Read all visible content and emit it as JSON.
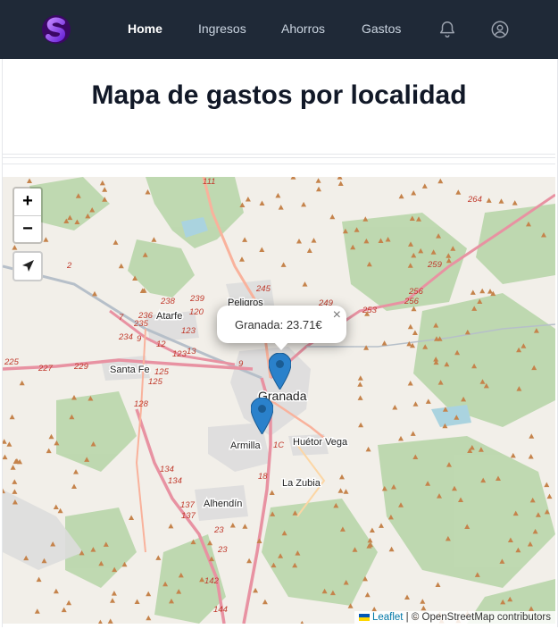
{
  "nav": {
    "links": [
      {
        "label": "Home",
        "active": true
      },
      {
        "label": "Ingresos",
        "active": false
      },
      {
        "label": "Ahorros",
        "active": false
      },
      {
        "label": "Gastos",
        "active": false
      }
    ],
    "icons": [
      "logo-s-icon",
      "bell-icon",
      "user-icon"
    ]
  },
  "page": {
    "title": "Mapa de gastos por localidad"
  },
  "map": {
    "zoom_in": "+",
    "zoom_out": "−",
    "locate_icon": "location-arrow-icon",
    "popup": {
      "text": "Granada: 23.71€",
      "close": "×"
    },
    "markers": [
      {
        "name": "Granada",
        "amount": "23.71€"
      },
      {
        "name": "Armilla"
      }
    ],
    "places": {
      "granada": "Granada",
      "armilla": "Armilla",
      "huetor": "Huétor Vega",
      "zubia": "La Zubia",
      "alhendin": "Alhendín",
      "santafe": "Santa Fe",
      "atarfe": "Atarfe",
      "peligros": "Peligros"
    },
    "road_numbers": {
      "r111": "111",
      "r264": "264",
      "r259": "259",
      "r256a": "256",
      "r256b": "256",
      "r253": "253",
      "r249": "249",
      "r245": "245",
      "r238": "238",
      "r239": "239",
      "r236": "236",
      "r235": "235",
      "r234": "234",
      "r227": "227",
      "r229": "229",
      "r225": "225",
      "r2": "2",
      "r7": "7",
      "r9a": "9",
      "r9b": "9",
      "r12": "12",
      "r123a": "123",
      "r123b": "123",
      "r13": "13",
      "r125a": "125",
      "r125b": "125",
      "r128": "128",
      "r134a": "134",
      "r134b": "134",
      "r137a": "137",
      "r137b": "137",
      "r23a": "23",
      "r23b": "23",
      "r142": "142",
      "r144": "144",
      "r18": "18",
      "r1c": "1C",
      "r120": "120"
    },
    "colors": {
      "land": "#f2efe9",
      "forest": "#add19e",
      "motorway": "#e892a2",
      "trunk": "#f9b29c",
      "urban": "#dddddd",
      "water": "#aad3df",
      "peak": "#c5834b",
      "marker": "#2a81cb"
    },
    "attribution": {
      "leaflet": "Leaflet",
      "rest": " | © OpenStreetMap contributors"
    }
  }
}
